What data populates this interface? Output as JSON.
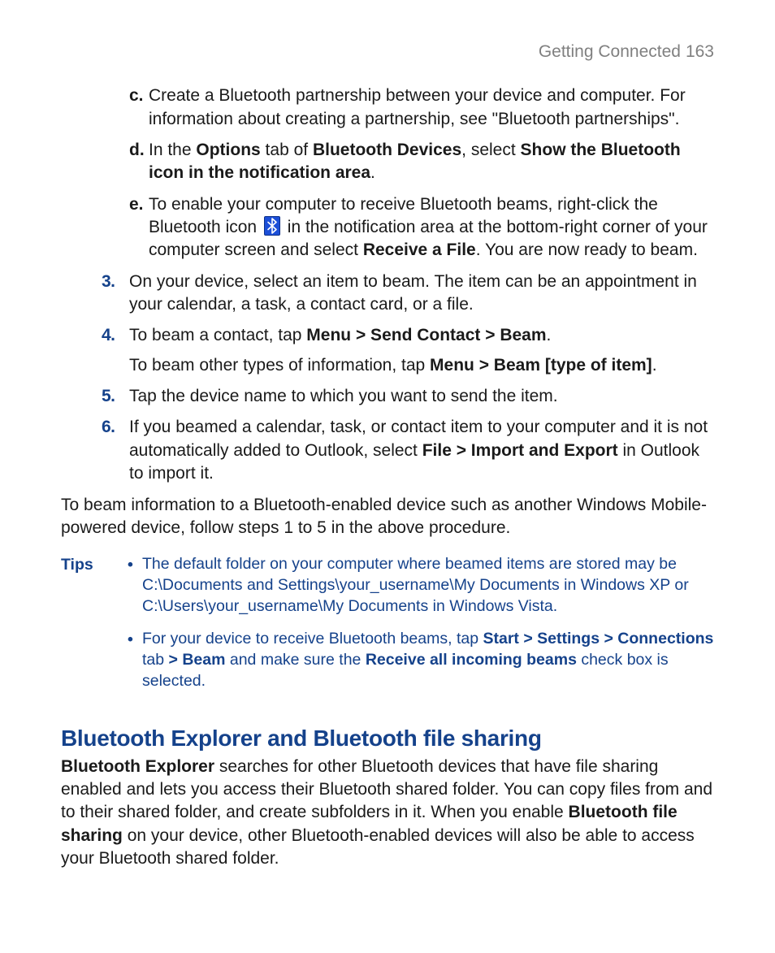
{
  "header": {
    "section": "Getting Connected",
    "page": "163"
  },
  "substeps": [
    {
      "marker": "c.",
      "html": "Create a Bluetooth partnership between your device and computer. For information about creating a partnership, see \"Bluetooth partnerships\"."
    },
    {
      "marker": "d.",
      "html": "In the <b>Options</b> tab of <b>Bluetooth Devices</b>, select <b>Show the Bluetooth icon in the notification area</b>."
    },
    {
      "marker": "e.",
      "html_pre": "To enable your computer to receive Bluetooth beams, right-click the Bluetooth icon ",
      "html_post": " in the notification area at the bottom-right corner of your computer screen and select <b>Receive a File</b>. You are now ready to beam.",
      "has_icon": true
    }
  ],
  "steps": [
    {
      "marker": "3.",
      "html": "On your device, select an item to beam. The item can be an appointment in your calendar, a task, a contact card, or a file."
    },
    {
      "marker": "4.",
      "html": "To beam a contact, tap <b>Menu > Send Contact > Beam</b>.",
      "html2": "To beam other types of information, tap <b>Menu > Beam [type of item]</b>."
    },
    {
      "marker": "5.",
      "html": "Tap the device name to which you want to send the item."
    },
    {
      "marker": "6.",
      "html": "If you beamed a calendar, task, or contact item to your computer and it is not automatically added to Outlook, select <b>File > Import and Export</b> in Outlook to import it."
    }
  ],
  "closing": "To beam information to a Bluetooth-enabled device such as another Windows Mobile-powered device, follow steps 1 to 5 in the above procedure.",
  "tips": {
    "label": "Tips",
    "items": [
      {
        "html": "The default folder on your computer where beamed items are stored may be C:\\Documents and Settings\\your_username\\My Documents in Windows XP or C:\\Users\\your_username\\My Documents in Windows Vista."
      },
      {
        "html": "For your device to receive Bluetooth beams, tap <b>Start > Settings > Connections</b> tab <b>> Beam</b> and make sure the <b>Receive all incoming beams</b> check box is selected."
      }
    ]
  },
  "section": {
    "heading": "Bluetooth Explorer and Bluetooth file sharing",
    "body_html": "<b>Bluetooth Explorer</b> searches for other Bluetooth devices that have file sharing enabled and lets you access their Bluetooth shared folder. You can copy files from and to their shared folder, and create subfolders in it. When you enable <b>Bluetooth file sharing</b> on your device, other Bluetooth-enabled devices will also be able to access your Bluetooth shared folder."
  }
}
